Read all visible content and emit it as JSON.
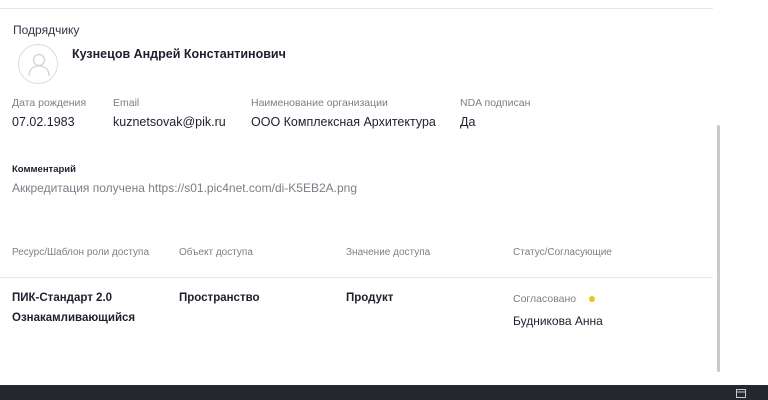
{
  "section": {
    "title": "Подрядчику"
  },
  "person": {
    "name": "Кузнецов Андрей Константинович"
  },
  "fields": [
    {
      "label": "Дата рождения",
      "value": "07.02.1983"
    },
    {
      "label": "Email",
      "value": "kuznetsovak@pik.ru"
    },
    {
      "label": "Наименование организации",
      "value": "ООО Комплексная Архитектура"
    },
    {
      "label": "NDA подписан",
      "value": "Да"
    }
  ],
  "comment": {
    "label": "Комментарий",
    "text": "Аккредитация получена https://s01.pic4net.com/di-K5EB2A.png"
  },
  "access_table": {
    "headers": [
      "Ресурс/Шаблон роли доступа",
      "Объект доступа",
      "Значение доступа",
      "Статус/Согласующие"
    ],
    "row": {
      "resource": "ПИК-Стандарт 2.0",
      "role": "Ознакамливающийся",
      "object": "Пространство",
      "value": "Продукт",
      "status": "Согласовано",
      "status_color": "#f0c419",
      "approver": "Будникова Анна"
    }
  }
}
